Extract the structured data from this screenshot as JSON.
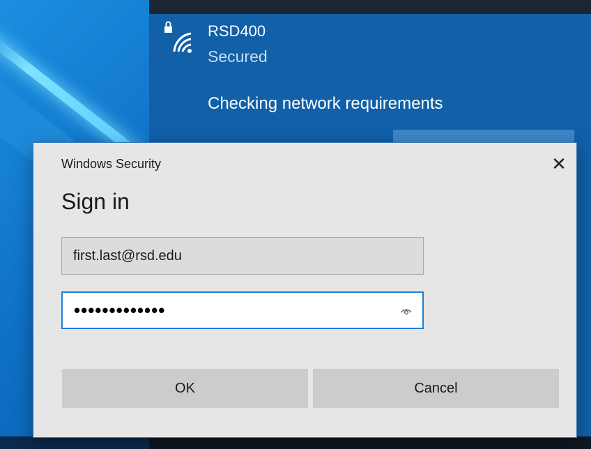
{
  "network": {
    "name": "RSD400",
    "status": "Secured",
    "progress_text": "Checking network requirements"
  },
  "dialog": {
    "title": "Windows Security",
    "close_glyph": "✕",
    "heading": "Sign in",
    "username_value": "first.last@rsd.edu",
    "password_mask": "•••••••••••••",
    "ok_label": "OK",
    "cancel_label": "Cancel"
  },
  "icons": {
    "wifi": "wifi-secured-icon",
    "reveal": "eye-icon",
    "close": "close-icon"
  },
  "colors": {
    "flyout_bg": "#1160a8",
    "dialog_bg": "#e6e6e6",
    "focus_border": "#1e7fd8",
    "button_bg": "#cccccc"
  }
}
